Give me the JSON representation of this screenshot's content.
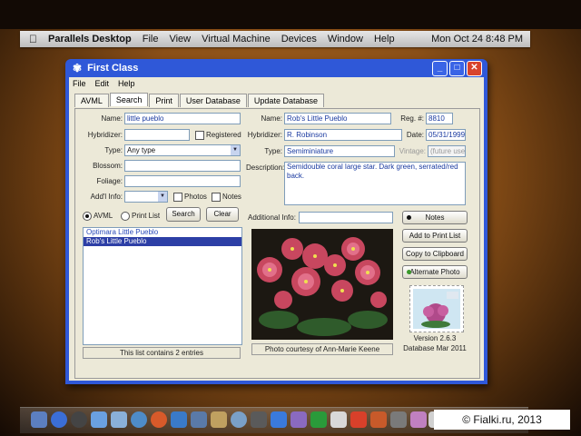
{
  "mac_menubar": {
    "apple": "",
    "app": "Parallels Desktop",
    "items": [
      "File",
      "View",
      "Virtual Machine",
      "Devices",
      "Window",
      "Help"
    ],
    "clock": "Mon Oct 24  8:48 PM"
  },
  "window": {
    "title": "First Class",
    "menu": [
      "File",
      "Edit",
      "Help"
    ],
    "tabs": [
      "AVML",
      "Search",
      "Print",
      "User Database",
      "Update Database"
    ],
    "active_tab": "Search"
  },
  "search": {
    "name_label": "Name:",
    "name_value": "little pueblo",
    "hybridizer_label": "Hybridizer:",
    "registered_label": "Registered",
    "type_label": "Type:",
    "type_value": "Any type",
    "blossom_label": "Blossom:",
    "foliage_label": "Foliage:",
    "addl_label": "Add'l Info:",
    "photos_label": "Photos",
    "notes_label": "Notes",
    "radio_avml": "AVML",
    "radio_print": "Print List",
    "search_btn": "Search",
    "clear_btn": "Clear",
    "results": [
      "Optimara Little Pueblo",
      "Rob's Little Pueblo"
    ],
    "status": "This list contains 2 entries"
  },
  "detail": {
    "name_label": "Name:",
    "name_value": "Rob's Little Pueblo",
    "reg_label": "Reg. #:",
    "reg_value": "8810",
    "hyb_label": "Hybridizer:",
    "hyb_value": "R. Robinson",
    "date_label": "Date:",
    "date_value": "05/31/1999",
    "type_label": "Type:",
    "type_value": "Semiminiature",
    "vintage_label": "Vintage:",
    "vintage_value": "(future use)",
    "desc_label": "Description:",
    "desc_value": "Semidouble coral large star. Dark green, serrated/red back.",
    "addl_label": "Additional Info:",
    "photo_caption": "Photo courtesy of Ann-Marie Keene"
  },
  "side_buttons": {
    "notes": "Notes",
    "add_print": "Add to Print List",
    "copy": "Copy to Clipboard",
    "alt_photo": "Alternate Photo",
    "version": "Version 2.6.3",
    "database": "Database Mar 2011"
  },
  "watermark": "© Fialki.ru, 2013",
  "colors": {
    "titlebar": "#2f58d8",
    "selection": "#2d3fa6",
    "window_bg": "#ece9d8"
  }
}
